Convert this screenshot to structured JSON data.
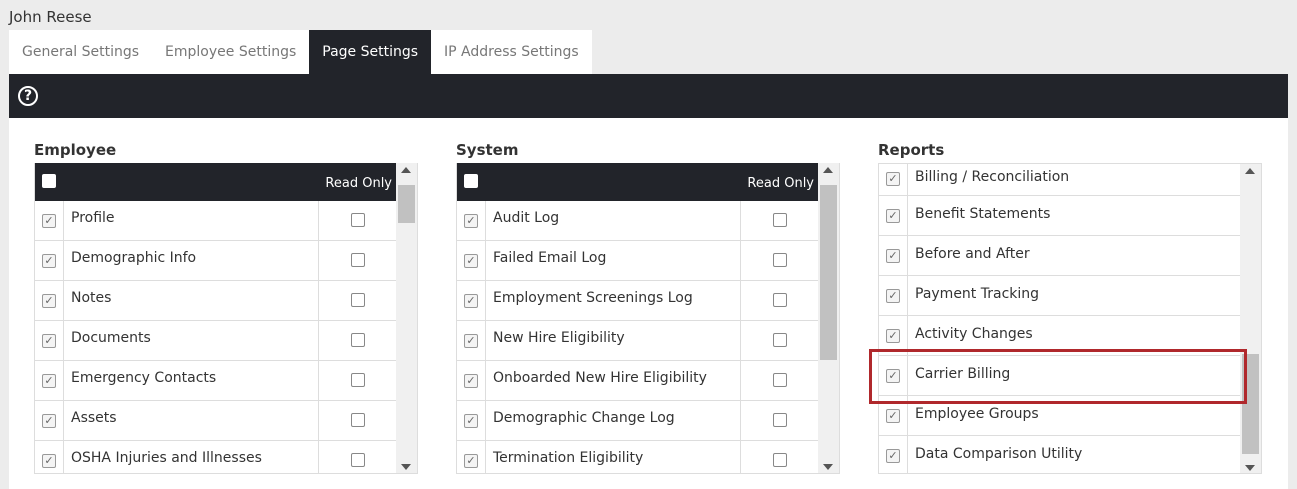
{
  "user": {
    "name": "John Reese"
  },
  "tabs": [
    {
      "label": "General Settings"
    },
    {
      "label": "Employee Settings"
    },
    {
      "label": "Page Settings"
    },
    {
      "label": "IP Address Settings"
    }
  ],
  "toolbar": {
    "help_icon": "help-icon",
    "help_glyph": "?"
  },
  "sections": {
    "employee": {
      "title": "Employee",
      "read_only_label": "Read Only",
      "items": [
        {
          "label": "Profile",
          "checked": true,
          "read_only": false
        },
        {
          "label": "Demographic Info",
          "checked": true,
          "read_only": false
        },
        {
          "label": "Notes",
          "checked": true,
          "read_only": false
        },
        {
          "label": "Documents",
          "checked": true,
          "read_only": false
        },
        {
          "label": "Emergency Contacts",
          "checked": true,
          "read_only": false
        },
        {
          "label": "Assets",
          "checked": true,
          "read_only": false
        },
        {
          "label": "OSHA Injuries and Illnesses",
          "checked": true,
          "read_only": false
        }
      ]
    },
    "system": {
      "title": "System",
      "read_only_label": "Read Only",
      "items": [
        {
          "label": "Audit Log",
          "checked": true,
          "read_only": false
        },
        {
          "label": "Failed Email Log",
          "checked": true,
          "read_only": false
        },
        {
          "label": "Employment Screenings Log",
          "checked": true,
          "read_only": false
        },
        {
          "label": "New Hire Eligibility",
          "checked": true,
          "read_only": false
        },
        {
          "label": "Onboarded New Hire Eligibility",
          "checked": true,
          "read_only": false
        },
        {
          "label": "Demographic Change Log",
          "checked": true,
          "read_only": false
        },
        {
          "label": "Termination Eligibility",
          "checked": true,
          "read_only": false
        }
      ]
    },
    "reports": {
      "title": "Reports",
      "items": [
        {
          "label": "Billing / Reconciliation",
          "checked": true
        },
        {
          "label": "Benefit Statements",
          "checked": true
        },
        {
          "label": "Before and After",
          "checked": true
        },
        {
          "label": "Payment Tracking",
          "checked": true
        },
        {
          "label": "Activity Changes",
          "checked": true
        },
        {
          "label": "Carrier Billing",
          "checked": true
        },
        {
          "label": "Employee Groups",
          "checked": true
        },
        {
          "label": "Data Comparison Utility",
          "checked": true
        }
      ],
      "highlighted_item": "Carrier Billing"
    }
  },
  "colors": {
    "dark_bar": "#22242a",
    "highlight": "#b0282c",
    "background": "#ececec"
  }
}
